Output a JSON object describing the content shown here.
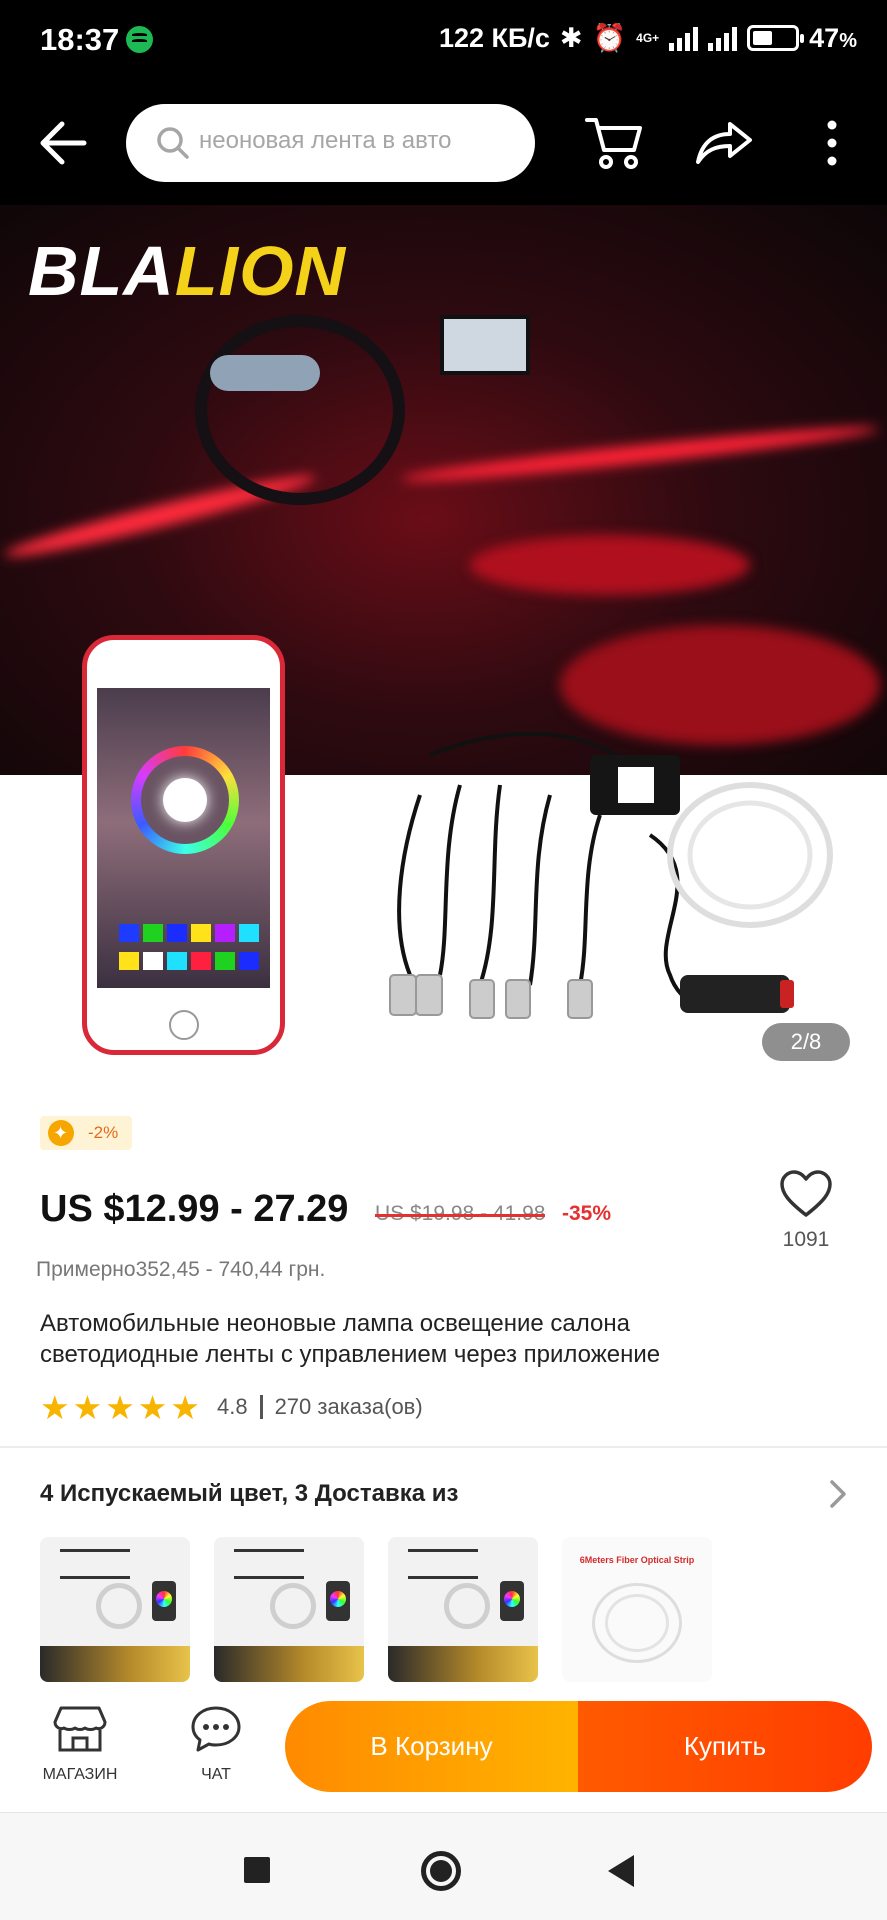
{
  "status_bar": {
    "time": "18:37",
    "speed": "122 КБ/с",
    "network": "4G+",
    "battery": "47",
    "battery_unit": "%",
    "battery_level": 0.47
  },
  "search": {
    "placeholder": "неоновая лента в авто"
  },
  "hero": {
    "brand_white": "BLA",
    "brand_yellow": "LION",
    "counter": "2/8"
  },
  "product": {
    "coupon": "-2%",
    "price": "US $12.99 - 27.29",
    "old_price": "US $19.98 - 41.98",
    "discount": "-35%",
    "wishlist_count": "1091",
    "approx_price": "Примерно352,45 - 740,44 грн.",
    "title": "Автомобильные неоновые лампа освещение салона светодиодные ленты с управлением через приложение",
    "rating": "4.8",
    "rating_stars": 5,
    "orders": "270 заказа(ов)"
  },
  "variants": {
    "header": "4 Испускаемый цвет, 3 Доставка из",
    "thumb4_label": "6Meters Fiber Optical Strip"
  },
  "action_bar": {
    "store_label": "МАГАЗИН",
    "chat_label": "ЧАТ",
    "add_to_cart": "В Корзину",
    "buy_now": "Купить"
  },
  "colors": {
    "accent_orange": "#ff8a00",
    "buy_red": "#ff4a00",
    "discount_red": "#e53030",
    "star_yellow": "#f7b500"
  }
}
